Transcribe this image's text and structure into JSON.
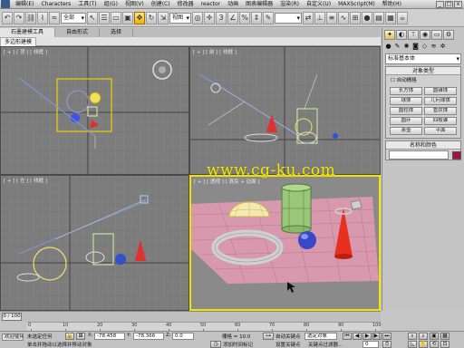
{
  "titlebar": {
    "menu": [
      "编辑(E)",
      "Characters",
      "工具(T)",
      "组(G)",
      "视图(V)",
      "创建(C)",
      "修改器",
      "reactor",
      "动画",
      "图表编辑器",
      "渲染(R)",
      "自定义(U)",
      "MAXScript(M)",
      "帮助(H)"
    ],
    "win": [
      "_",
      "□",
      "x"
    ]
  },
  "toolbar": {
    "filter_select": "全部",
    "refcoord_select": "视图",
    "selset_select": "",
    "icons": [
      "undo",
      "redo",
      "link",
      "unlink",
      "bind",
      "select",
      "select-region",
      "select-name",
      "move",
      "rotate",
      "scale",
      "mirror",
      "align",
      "snap",
      "angle-snap",
      "percent-snap",
      "spinner-snap",
      "layer",
      "curve",
      "schematic",
      "material",
      "render-setup",
      "quick-render",
      "render"
    ]
  },
  "tabs": [
    "石墨建模工具",
    "自由形式",
    "选择"
  ],
  "subtab": "多边形建模",
  "viewports": {
    "top": "[ + ] [ 顶 ] [ 线框 ]",
    "front": "[ + ] [ 前 ] [ 线框 ]",
    "left": "[ + ] [ 左 ] [ 线框 ]",
    "persp": "[ + ] [ 透视 ] [ 真实 + 边面 ]"
  },
  "watermark": "www.cg-ku.com",
  "command_panel": {
    "category_select": "标准基本体",
    "rollout_object_type": "对象类型",
    "autogrid_label": "自动栅格",
    "object_buttons": [
      "长方体",
      "圆锥体",
      "球体",
      "几何球体",
      "圆柱体",
      "管状体",
      "圆环",
      "四棱锥",
      "茶壶",
      "平面"
    ],
    "rollout_name_color": "名称和颜色",
    "name_field": "",
    "color_hex": "#a0104a"
  },
  "timeline": {
    "frame_counter": "0 / 100",
    "ticks": [
      "0",
      "10",
      "20",
      "30",
      "40",
      "50",
      "60",
      "70",
      "80",
      "90",
      "100"
    ]
  },
  "status": {
    "selection_text": "未选定任何",
    "maxscript_label": "欢迎使用 MAXSc",
    "prompt_text": "单击并拖动以选择并移动对象",
    "x_label": "X:",
    "x_value": "-78.458",
    "y_label": "Y:",
    "y_value": "-78.366",
    "z_label": "Z:",
    "z_value": "0.0",
    "grid_text": "栅格 = 10.0",
    "autokey_label": "自动关键点",
    "selected_label": "选定对象",
    "setkey_label": "设置关键点",
    "keyfilter_label": "关键点过滤器...",
    "add_time_tag": "添加时间标记",
    "frame_field": "0"
  }
}
